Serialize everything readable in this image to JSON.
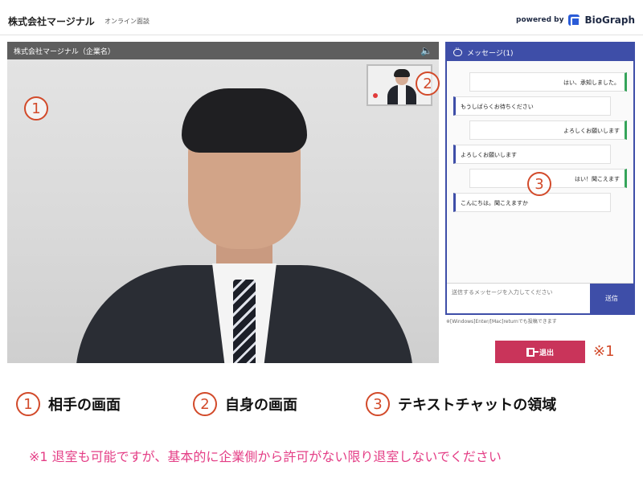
{
  "app": {
    "company": "株式会社マージナル",
    "subtitle": "オンライン面談",
    "powered_by": "powered by",
    "brand": "BioGraph"
  },
  "video": {
    "title": "株式会社マージナル（企業名）",
    "icons": [
      "speaker-icon"
    ]
  },
  "chat": {
    "title": "メッセージ(1)",
    "messages": [
      {
        "text": "はい、承知しました。",
        "direction": "out"
      },
      {
        "text": "もうしばらくお待ちください",
        "direction": "in"
      },
      {
        "text": "よろしくお願いします",
        "direction": "out"
      },
      {
        "text": "よろしくお願いします",
        "direction": "in"
      },
      {
        "text": "はい！聞こえます",
        "direction": "out"
      },
      {
        "text": "こんにちは。聞こえますか",
        "direction": "in"
      }
    ],
    "input_placeholder": "送信するメッセージを入力してください",
    "send_label": "送信",
    "hint": "※[Windows]Enter/[Mac]returnでも投稿できます"
  },
  "actions": {
    "exit_label": "退出",
    "exit_note": "※1"
  },
  "annotations": {
    "one": "1",
    "two": "2",
    "three": "3"
  },
  "legend": {
    "items": [
      {
        "num": "1",
        "label": "相手の画面"
      },
      {
        "num": "2",
        "label": "自身の画面"
      },
      {
        "num": "3",
        "label": "テキストチャットの領域"
      }
    ]
  },
  "footnote": "※1 退室も可能ですが、基本的に企業側から許可がない限り退室しないでください",
  "colors": {
    "accent": "#3e4ea8",
    "exit": "#c9345a",
    "annotation": "#d24a2a",
    "footnote": "#e43e86",
    "out_border": "#35a45a"
  }
}
